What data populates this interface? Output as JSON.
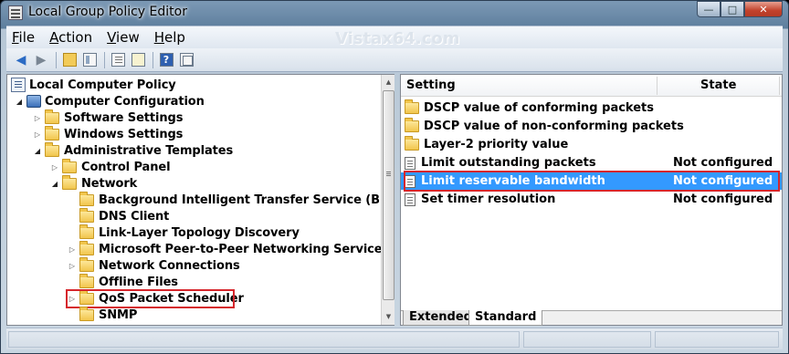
{
  "window": {
    "title": "Local Group Policy Editor"
  },
  "menu": [
    {
      "label_u": "F",
      "label_rest": "ile"
    },
    {
      "label_u": "A",
      "label_rest": "ction"
    },
    {
      "label_u": "V",
      "label_rest": "iew"
    },
    {
      "label_u": "H",
      "label_rest": "elp"
    }
  ],
  "watermark": "Vistax64.com",
  "tree": {
    "root": "Local Computer Policy",
    "computer_config": "Computer Configuration",
    "software_settings": "Software Settings",
    "windows_settings": "Windows Settings",
    "admin_templates": "Administrative Templates",
    "control_panel": "Control Panel",
    "network": "Network",
    "bits": "Background Intelligent Transfer Service (BITS)",
    "dns_client": "DNS Client",
    "lltd": "Link-Layer Topology Discovery",
    "p2p": "Microsoft Peer-to-Peer Networking Services",
    "net_conn": "Network Connections",
    "offline_files": "Offline Files",
    "qos": "QoS Packet Scheduler",
    "snmp": "SNMP"
  },
  "list": {
    "col_setting": "Setting",
    "col_state": "State",
    "rows": [
      {
        "setting": "DSCP value of conforming packets",
        "state": ""
      },
      {
        "setting": "DSCP value of non-conforming packets",
        "state": ""
      },
      {
        "setting": "Layer-2 priority value",
        "state": ""
      },
      {
        "setting": "Limit outstanding packets",
        "state": "Not configured"
      },
      {
        "setting": "Limit reservable bandwidth",
        "state": "Not configured"
      },
      {
        "setting": "Set timer resolution",
        "state": "Not configured"
      }
    ]
  },
  "tabs": {
    "extended": "Extended",
    "standard": "Standard"
  },
  "colors": {
    "selection": "#3399ff",
    "highlight_box": "#d6262c"
  }
}
